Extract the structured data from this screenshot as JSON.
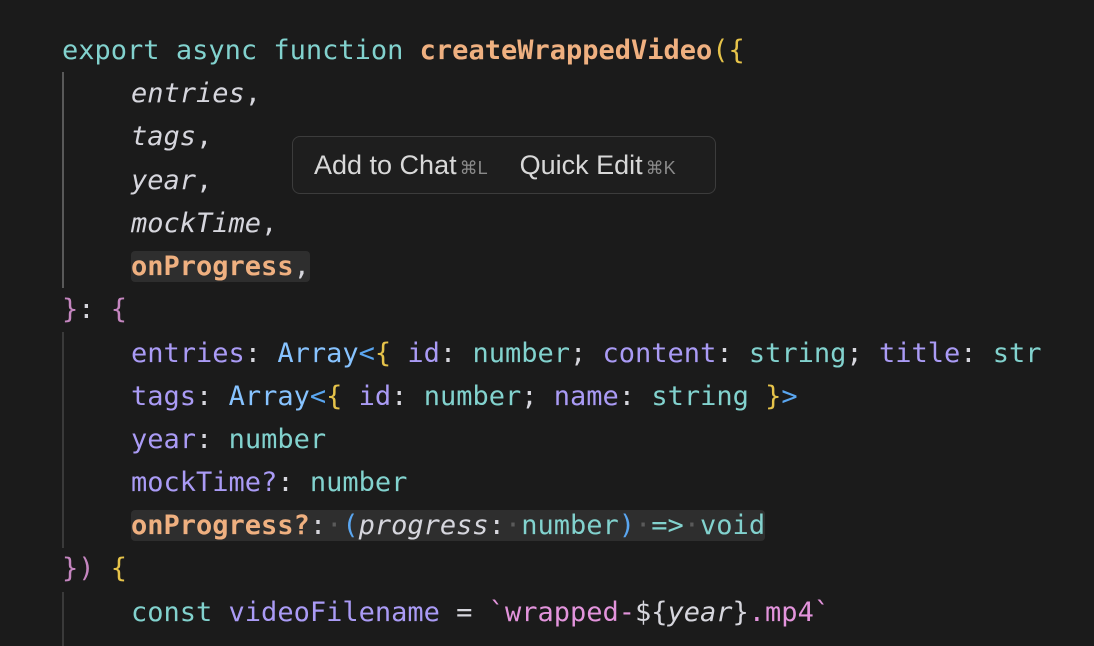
{
  "code": {
    "l1": {
      "kw1": "export",
      "kw2": "async",
      "kw3": "function",
      "name": "createWrappedVideo",
      "open": "({"
    },
    "l2": {
      "param": "entries",
      "comma": ","
    },
    "l3": {
      "param": "tags",
      "comma": ","
    },
    "l4": {
      "param": "year",
      "comma": ","
    },
    "l5": {
      "param": "mockTime",
      "comma": ","
    },
    "l6": {
      "param": "onProgress",
      "comma": ","
    },
    "l7": {
      "close": "}",
      "colon": ":",
      "open": "{"
    },
    "l8": {
      "prop": "entries",
      "colon": ":",
      "type": "Array",
      "lt": "<",
      "ob": "{",
      "p1": "id",
      "c1": ":",
      "t1": "number",
      "s1": ";",
      "p2": "content",
      "c2": ":",
      "t2": "string",
      "s2": ";",
      "p3": "title",
      "c3": ":",
      "t3": "str"
    },
    "l9": {
      "prop": "tags",
      "colon": ":",
      "type": "Array",
      "lt": "<",
      "ob": "{",
      "p1": "id",
      "c1": ":",
      "t1": "number",
      "s1": ";",
      "p2": "name",
      "c2": ":",
      "t2": "string",
      "cb": "}",
      "gt": ">"
    },
    "l10": {
      "prop": "year",
      "colon": ":",
      "type": "number"
    },
    "l11": {
      "prop": "mockTime?",
      "colon": ":",
      "type": "number"
    },
    "l12": {
      "prop": "onProgress?",
      "colon": ":",
      "op": "(",
      "param": "progress",
      "c": ":",
      "type": "number",
      "cp": ")",
      "arrow": "=>",
      "ret": "void"
    },
    "l13": {
      "close": "})",
      "open": "{"
    },
    "l14": {
      "kw": "const",
      "var": "videoFilename",
      "eq": "=",
      "tick1": "`",
      "str1": "wrapped-",
      "dollar": "${",
      "tplvar": "year",
      "tplclose": "}",
      "str2": ".mp4",
      "tick2": "`"
    }
  },
  "popup": {
    "add_label": "Add to Chat",
    "add_key": "⌘L",
    "edit_label": "Quick Edit",
    "edit_key": "⌘K"
  }
}
